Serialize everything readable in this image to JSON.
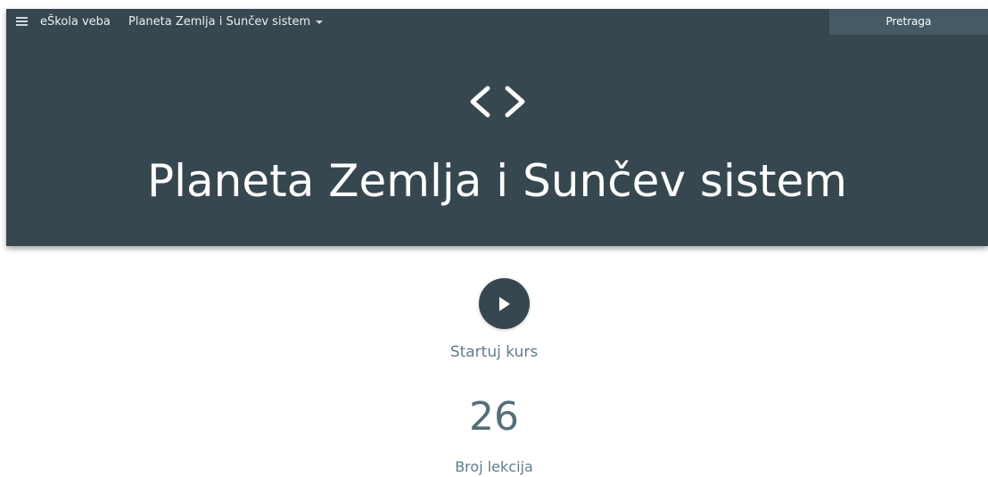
{
  "topbar": {
    "menu_icon": "menu-icon",
    "brand": "eŠkola veba",
    "course_select": "Planeta Zemlja i Sunčev sistem",
    "search_label": "Pretraga"
  },
  "hero": {
    "icon": "code-icon",
    "icon_text": "< >",
    "title": "Planeta Zemlja i Sunčev sistem",
    "background_color": "#37474f"
  },
  "main": {
    "play_icon": "play-icon",
    "start_label": "Startuj kurs",
    "lesson_count": "26",
    "lesson_label": "Broj lekcija"
  }
}
